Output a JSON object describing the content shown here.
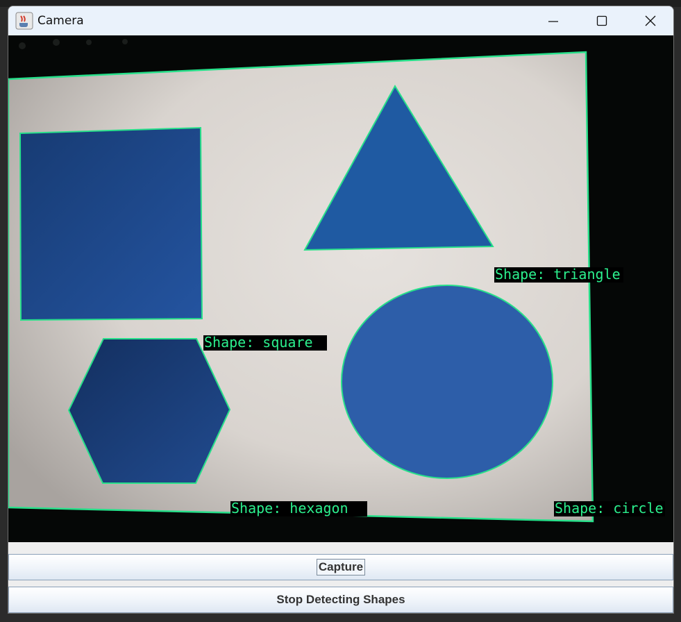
{
  "window": {
    "title": "Camera",
    "icons": {
      "app": "java-cup-icon",
      "minimize": "minimize-icon",
      "maximize": "maximize-icon",
      "close": "close-icon"
    }
  },
  "camera": {
    "labels": {
      "triangle": "Shape: triangle",
      "square": "Shape: square",
      "hexagon": "Shape: hexagon",
      "circle": "Shape: circle"
    },
    "colors": {
      "outline": "#27e08a",
      "label_text": "#2cf08e",
      "label_bg": "#000000",
      "shape_fill": "#1f55a0"
    }
  },
  "buttons": {
    "capture": "Capture",
    "stop": "Stop Detecting Shapes"
  }
}
